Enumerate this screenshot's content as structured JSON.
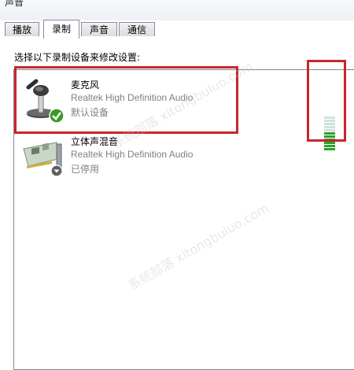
{
  "window": {
    "title": "声音"
  },
  "tabs": [
    {
      "label": "播放",
      "active": false
    },
    {
      "label": "录制",
      "active": true
    },
    {
      "label": "声音",
      "active": false
    },
    {
      "label": "通信",
      "active": false
    }
  ],
  "instruction": "选择以下录制设备来修改设置:",
  "devices": [
    {
      "name": "麦克风",
      "description": "Realtek High Definition Audio",
      "status": "默认设备",
      "icon": "microphone-icon",
      "badge": "default-check-icon",
      "selected": true
    },
    {
      "name": "立体声混音",
      "description": "Realtek High Definition Audio",
      "status": "已停用",
      "icon": "sound-card-icon",
      "badge": "disabled-arrow-icon",
      "selected": false
    }
  ],
  "level_meter": {
    "segments": 11,
    "lit_segments": 6,
    "lit_color": "#2aa42a",
    "unlit_color": "#cfe3dc"
  },
  "highlight_color": "#c9262b",
  "watermark": "系统部落 xitongbuluo.com"
}
